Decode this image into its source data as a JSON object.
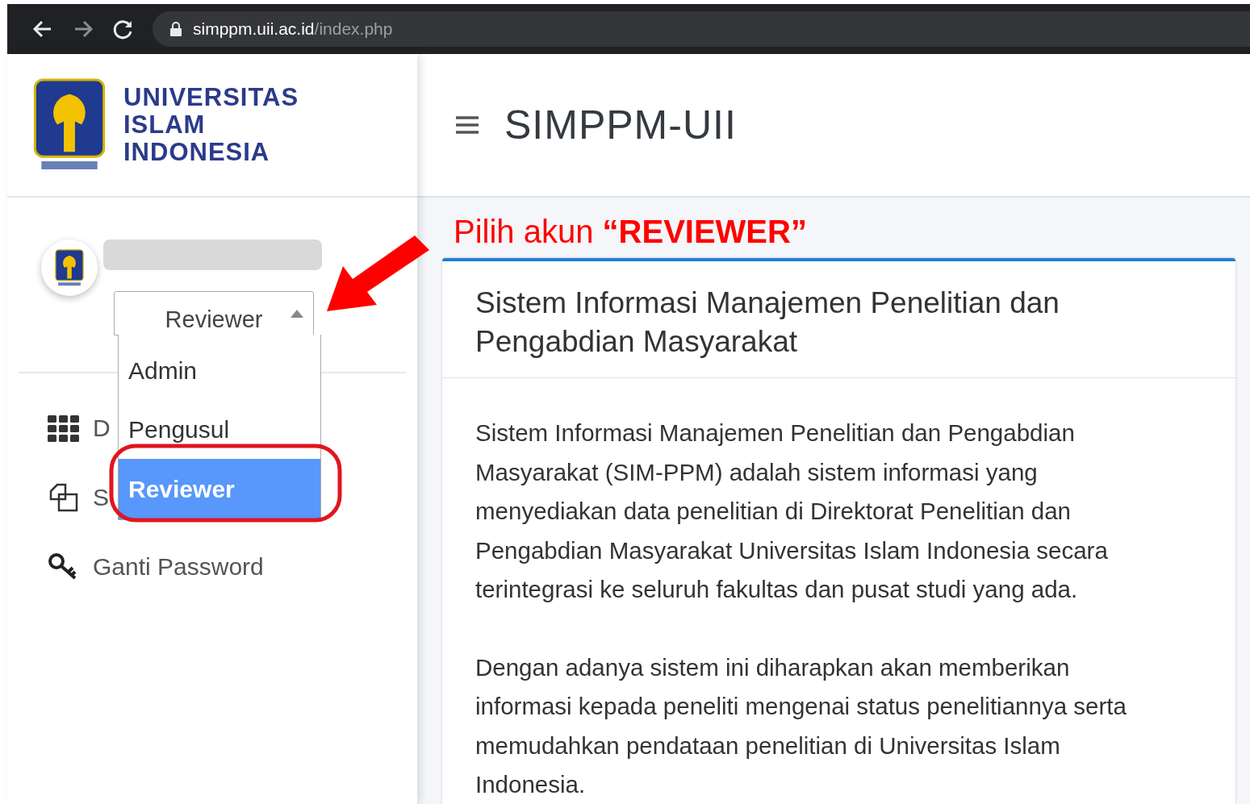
{
  "browser": {
    "url_host": "simppm.uii.ac.id",
    "url_path": "/index.php"
  },
  "sidebar": {
    "brand": [
      "UNIVERSITAS",
      "ISLAM",
      "INDONESIA"
    ],
    "role_select": {
      "value": "Reviewer",
      "expanded": true,
      "options": [
        {
          "label": "Admin",
          "selected": false
        },
        {
          "label": "Pengusul",
          "selected": false
        },
        {
          "label": "Reviewer",
          "selected": true
        }
      ]
    },
    "menu": [
      {
        "label": "D",
        "kind": "grid"
      },
      {
        "label": "S",
        "kind": "copy"
      },
      {
        "label": "Ganti Password",
        "kind": "key"
      }
    ]
  },
  "header": {
    "title": "SIMPPM-UII"
  },
  "annotation": {
    "text": "Pilih akun **“REVIEWER”**"
  },
  "card": {
    "title": "Sistem Informasi Manajemen Penelitian dan Pengabdian Masyarakat",
    "paragraphs": [
      "Sistem Informasi Manajemen Penelitian dan Pengabdian Masyarakat (SIM-PPM) adalah sistem informasi yang menyediakan data penelitian di Direktorat Penelitian dan Pengabdian Masyarakat Universitas Islam Indonesia secara terintegrasi ke seluruh fakultas dan pusat studi yang ada.",
      "Dengan adanya sistem ini diharapkan akan memberikan informasi kepada peneliti mengenai status penelitiannya serta memudahkan pendataan penelitian di Universitas Islam Indonesia."
    ]
  }
}
